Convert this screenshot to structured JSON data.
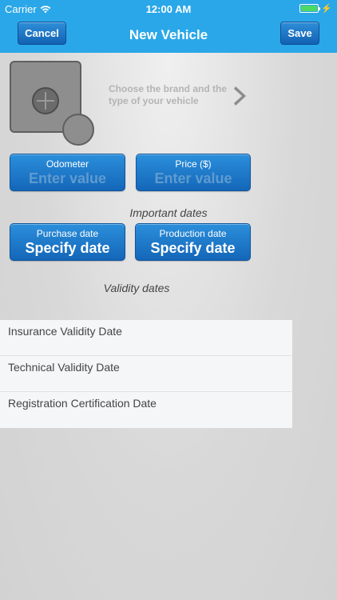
{
  "status_bar": {
    "carrier": "Carrier",
    "time": "12:00 AM"
  },
  "nav": {
    "cancel_label": "Cancel",
    "title": "New Vehicle",
    "save_label": "Save"
  },
  "brand": {
    "hint": "Choose the brand and the type of your vehicle"
  },
  "odometer": {
    "label": "Odometer",
    "placeholder": "Enter value"
  },
  "price": {
    "label": "Price ($)",
    "placeholder": "Enter value"
  },
  "important_dates": {
    "heading": "Important dates",
    "purchase": {
      "label": "Purchase date",
      "value": "Specify date"
    },
    "production": {
      "label": "Production date",
      "value": "Specify date"
    }
  },
  "validity": {
    "heading": "Validity dates",
    "items": [
      {
        "label": "Insurance Validity Date"
      },
      {
        "label": "Technical Validity Date"
      },
      {
        "label": "Registration Certification Date"
      }
    ]
  },
  "colors": {
    "accent": "#2aa7e8",
    "button": "#1a77c6",
    "battery": "#4cd964"
  }
}
